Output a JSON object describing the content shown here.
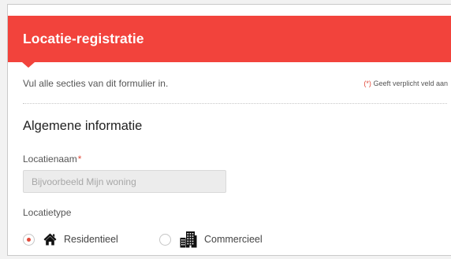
{
  "header": {
    "title": "Locatie-registratie"
  },
  "intro": {
    "text": "Vul alle secties van dit formulier in.",
    "required_note_marker": "(*)",
    "required_note_text": "Geeft verplicht veld aan"
  },
  "section": {
    "title": "Algemene informatie"
  },
  "location_name": {
    "label": "Locatienaam",
    "required_marker": "*",
    "value": "",
    "placeholder": "Bijvoorbeeld Mijn woning"
  },
  "location_type": {
    "label": "Locatietype",
    "options": [
      {
        "label": "Residentieel",
        "icon": "house-icon",
        "selected": true
      },
      {
        "label": "Commercieel",
        "icon": "office-building-icon",
        "selected": false
      }
    ]
  },
  "colors": {
    "header_bg": "#f2433c",
    "accent_red": "#e24b3b",
    "input_bg": "#ececec"
  }
}
